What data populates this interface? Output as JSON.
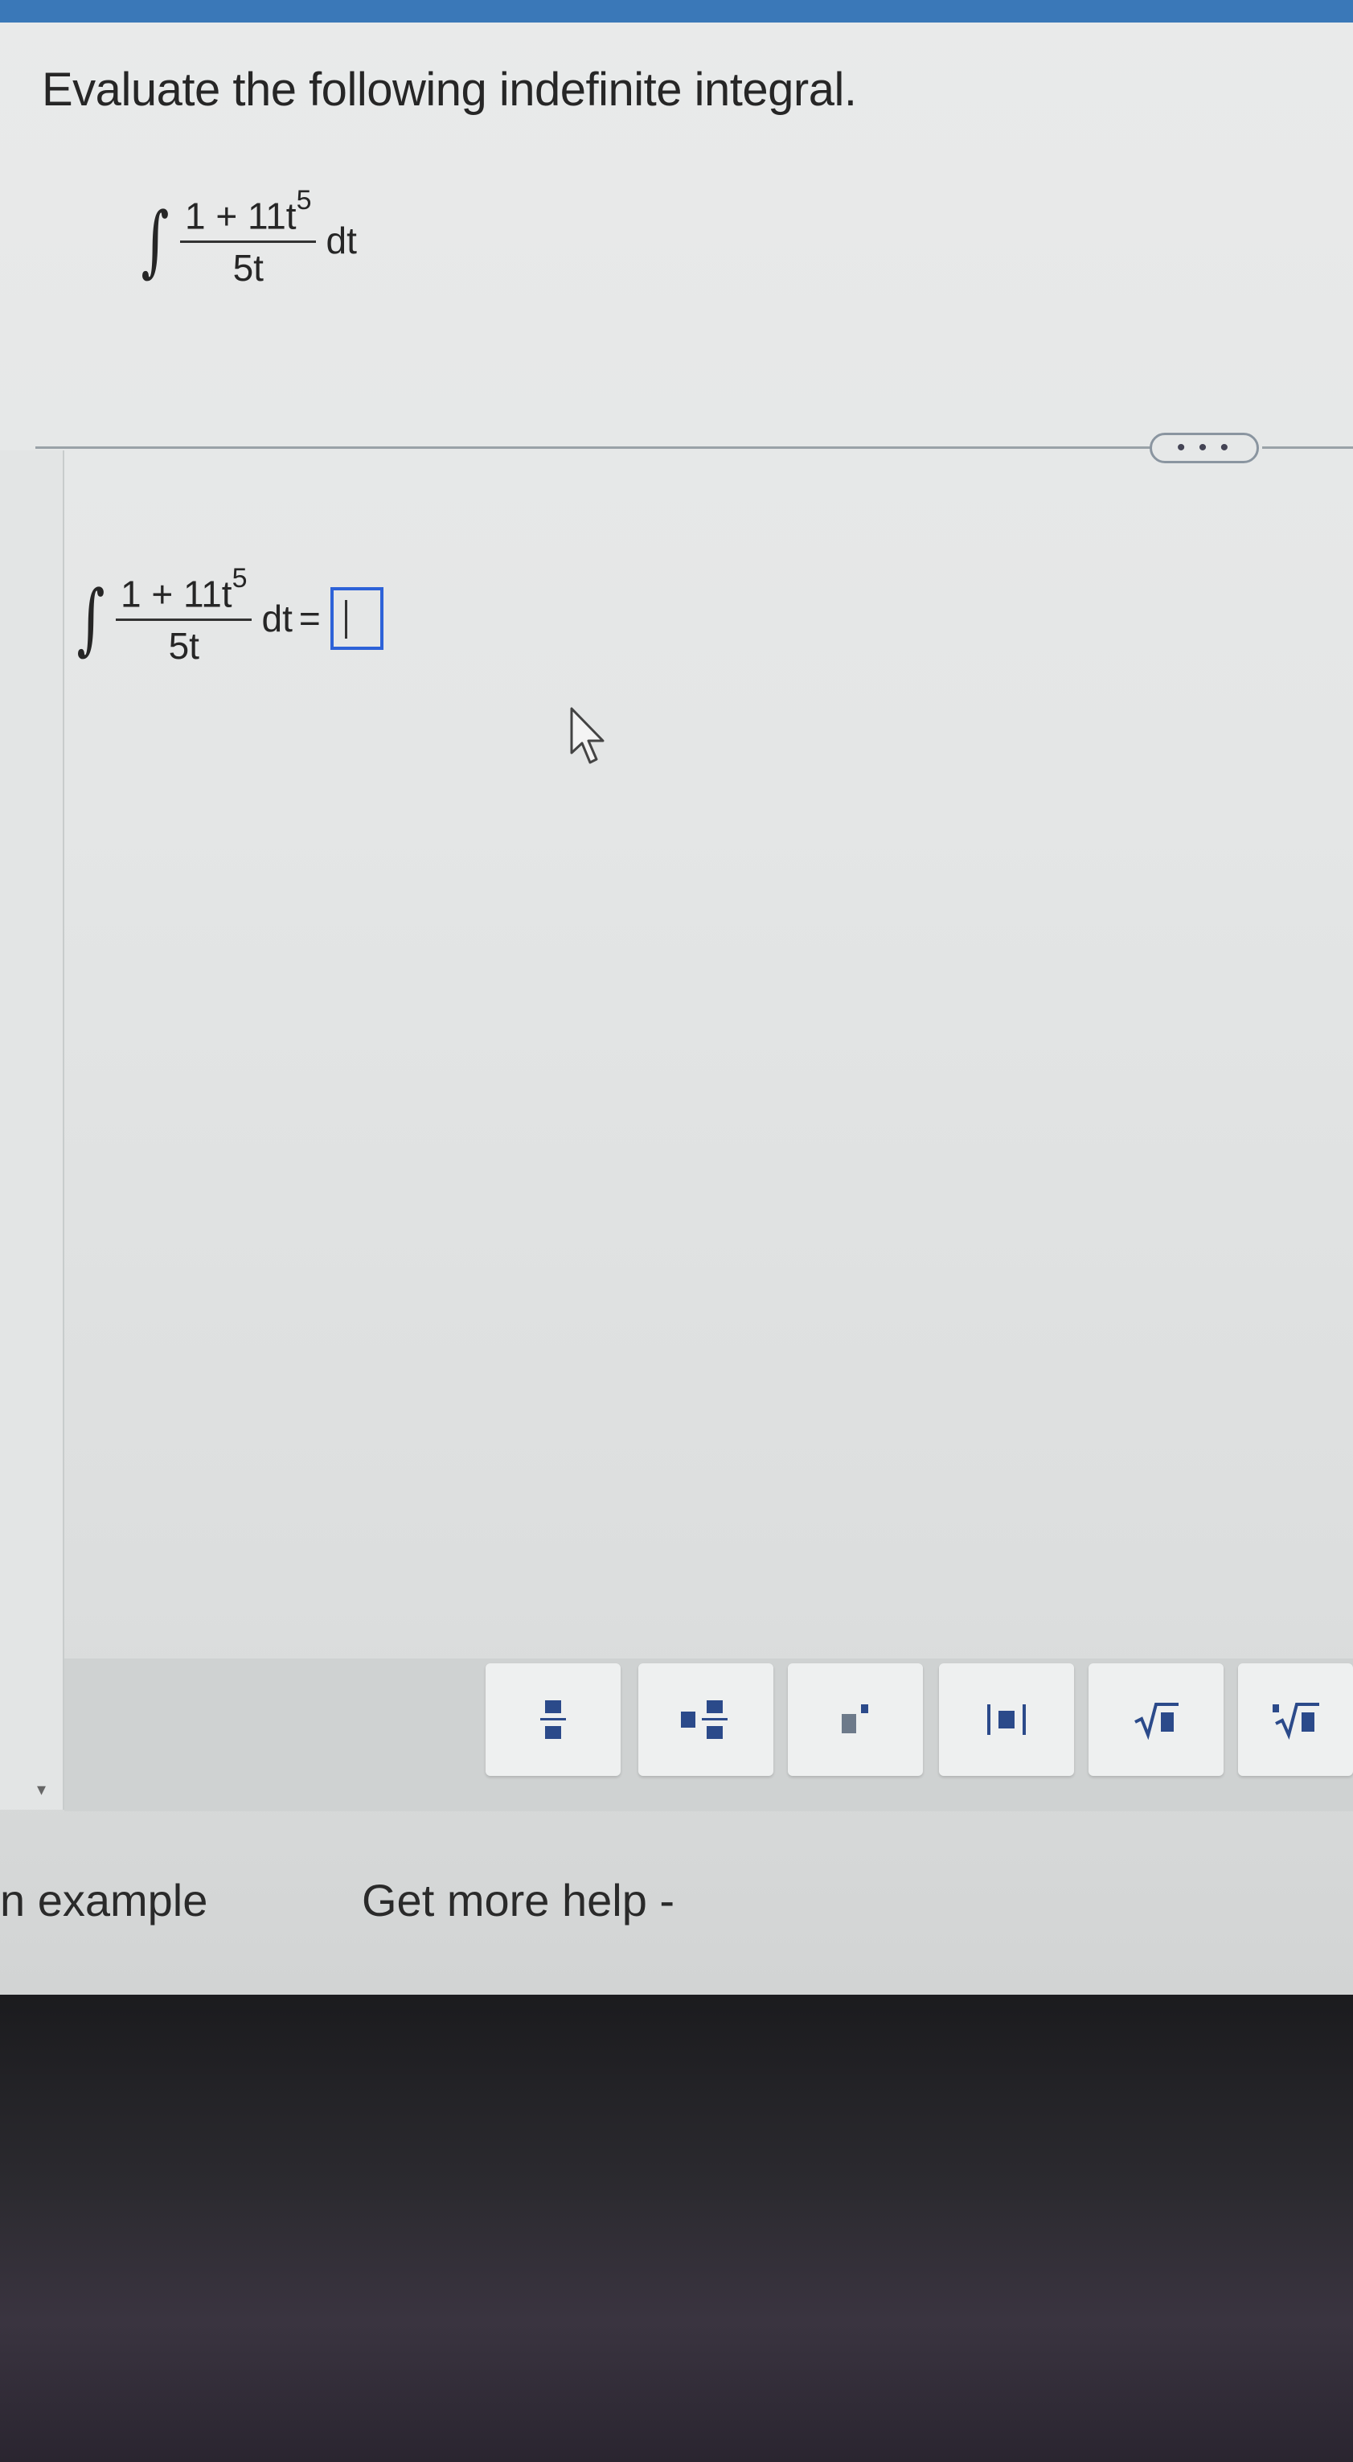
{
  "question": {
    "prompt": "Evaluate the following indefinite integral."
  },
  "integral": {
    "sign": "∫",
    "numerator_base": "1 + 11t",
    "numerator_exponent": "5",
    "denominator": "5t",
    "differential": "dt"
  },
  "answer": {
    "equals": "=",
    "value": ""
  },
  "divider": {
    "more_label": "• • •"
  },
  "palette": {
    "buttons": [
      {
        "name": "fraction",
        "glyph": "fraction"
      },
      {
        "name": "mixed-number",
        "glyph": "mixed-number"
      },
      {
        "name": "exponent",
        "glyph": "exponent"
      },
      {
        "name": "absolute-value",
        "glyph": "absolute-value"
      },
      {
        "name": "square-root",
        "glyph": "square-root"
      },
      {
        "name": "nth-root",
        "glyph": "nth-root"
      }
    ]
  },
  "footer": {
    "example_label": "n example",
    "help_label": "Get more help -"
  },
  "colors": {
    "answer_box_border": "#2d62d8",
    "header_bar": "#3a78b8"
  }
}
